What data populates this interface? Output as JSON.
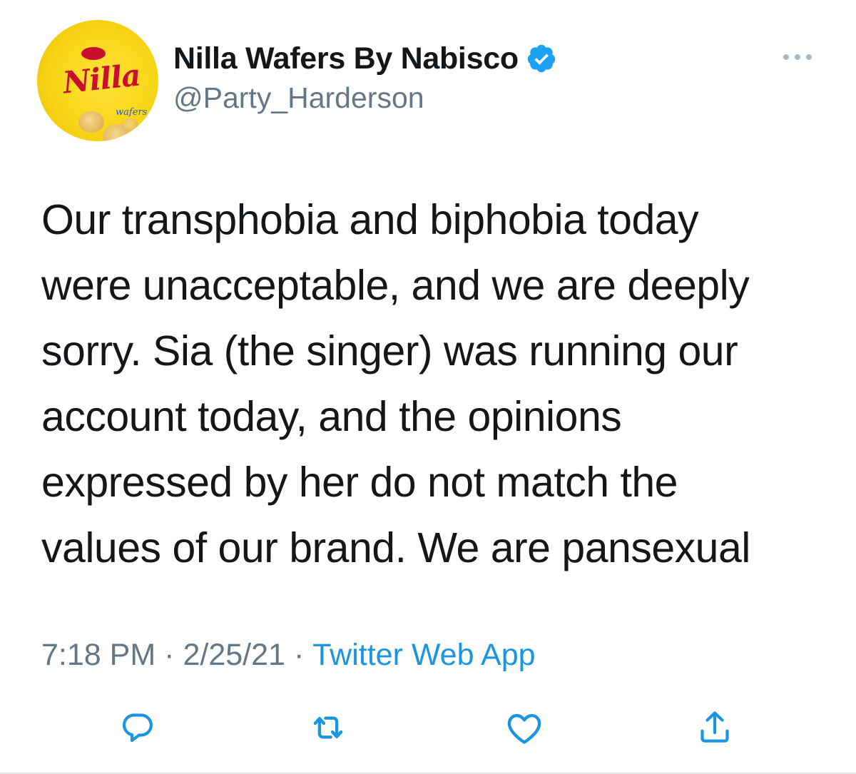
{
  "author": {
    "display_name": "Nilla Wafers By Nabisco",
    "handle": "@Party_Harderson",
    "verified": true,
    "avatar": {
      "logo_text": "Nilla",
      "sub_text": "wafers",
      "background_color": "#f7d414",
      "logo_color": "#c8102e"
    }
  },
  "tweet": {
    "text": "Our transphobia and biphobia today\nwere unacceptable, and we are deeply\nsorry. Sia (the singer) was running our\naccount today, and the opinions\nexpressed by her do not match the\nvalues of our brand. We are pansexual"
  },
  "meta": {
    "time": "7:18 PM",
    "separator": "·",
    "date": "2/25/21",
    "source": "Twitter Web App"
  },
  "icons": {
    "more": "more-horizontal-icon",
    "verified": "verified-badge-icon",
    "reply": "reply-icon",
    "retweet": "retweet-icon",
    "like": "heart-icon",
    "share": "share-icon"
  },
  "colors": {
    "text_primary": "#14171a",
    "text_secondary": "#657786",
    "link": "#1b95e0",
    "verified": "#1da1f2"
  }
}
